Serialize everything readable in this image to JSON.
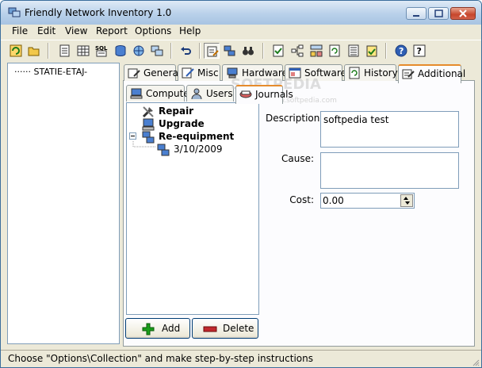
{
  "window": {
    "title": "Friendly Network Inventory 1.0"
  },
  "menu": [
    "File",
    "Edit",
    "View",
    "Report",
    "Options",
    "Help"
  ],
  "toolbar": {
    "sql_label": "SQL",
    "buttons": [
      "refresh",
      "open-folder",
      "notes",
      "grid-table",
      "sql-query",
      "database",
      "network-globe",
      "scan-computers",
      "undo",
      "edit-properties",
      "computers",
      "find-binoculars",
      "checklist",
      "tree-network",
      "structure",
      "document-refresh",
      "list-details",
      "notepad-check",
      "help",
      "help-context"
    ]
  },
  "tree": {
    "root": "STATIE-ETAJ-"
  },
  "tabs_main": [
    {
      "label": "General",
      "icon": "general-icon"
    },
    {
      "label": "Misc",
      "icon": "misc-icon"
    },
    {
      "label": "Hardware",
      "icon": "hardware-icon"
    },
    {
      "label": "Software",
      "icon": "software-icon"
    },
    {
      "label": "History",
      "icon": "history-icon"
    },
    {
      "label": "Additional",
      "icon": "additional-icon",
      "active": true
    }
  ],
  "tabs_sub": [
    {
      "label": "Computer",
      "icon": "computer-icon"
    },
    {
      "label": "Users",
      "icon": "users-icon"
    },
    {
      "label": "Journals",
      "icon": "journals-icon",
      "active": true
    }
  ],
  "journal_tree": {
    "items": [
      {
        "label": "Repair",
        "icon": "repair-icon"
      },
      {
        "label": "Upgrade",
        "icon": "upgrade-icon"
      },
      {
        "label": "Re-equipment",
        "icon": "re-equipment-icon",
        "expanded": true,
        "children": [
          {
            "label": "3/10/2009",
            "icon": "computers-icon"
          }
        ]
      }
    ]
  },
  "buttons": {
    "add": "Add",
    "delete": "Delete"
  },
  "form": {
    "description_label": "Description:",
    "description_value": "softpedia test",
    "cause_label": "Cause:",
    "cause_value": "",
    "cost_label": "Cost:",
    "cost_value": "0.00"
  },
  "status": {
    "text": "Choose \"Options\\Collection\" and make step-by-step instructions"
  },
  "watermark": {
    "text": "SOFTPEDIA",
    "url": "www.softpedia.com"
  },
  "colors": {
    "accent_tab": "#e68b2c",
    "add_green": "#1a9e1a",
    "delete_red": "#c0282e"
  }
}
